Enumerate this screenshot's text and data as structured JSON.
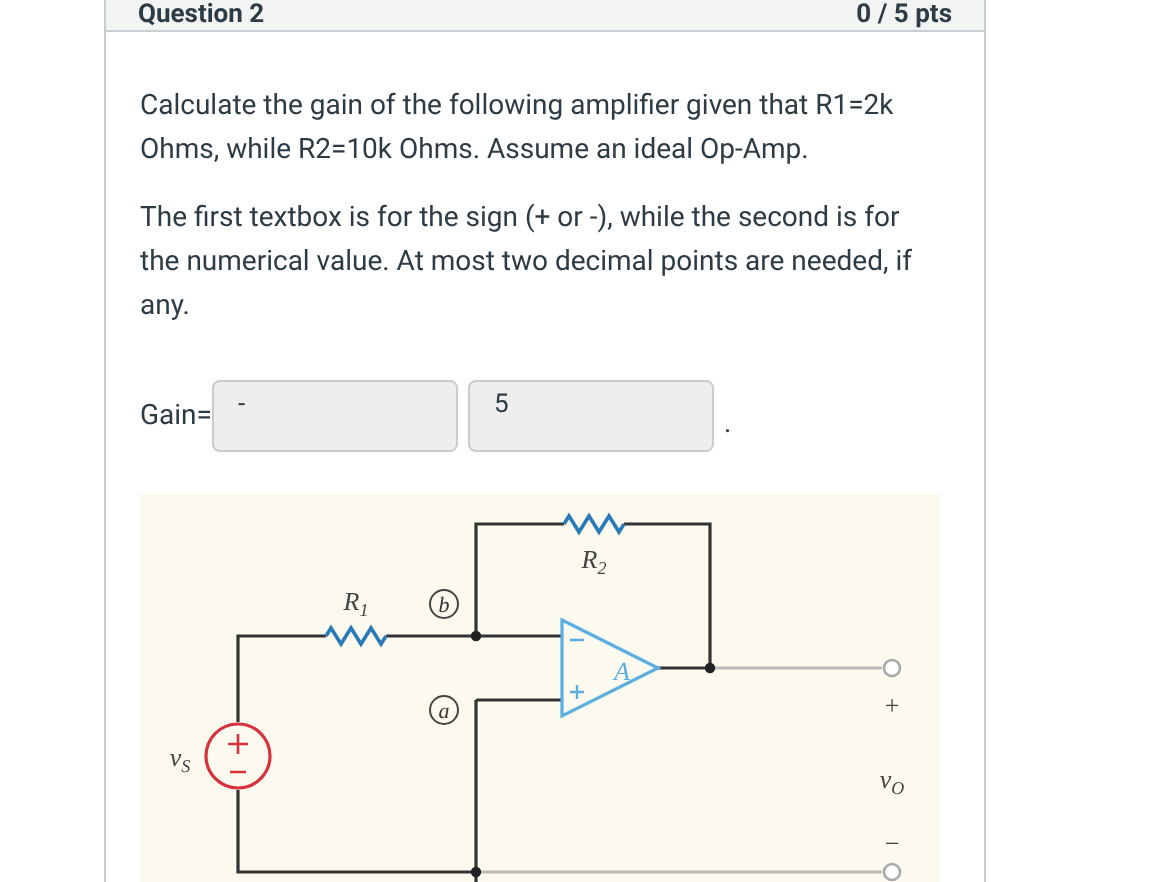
{
  "header": {
    "title": "Question 2",
    "points": "0 / 5 pts"
  },
  "paragraphs": [
    "Calculate the gain of the following amplifier given that R1=2k Ohms, while R2=10k Ohms. Assume an ideal Op-Amp.",
    "The first textbox is for the sign (+ or -), while the second is for the numerical value. At most two decimal points are needed, if any."
  ],
  "answer": {
    "label": "Gain=",
    "sign": "-",
    "value": "5",
    "end": "."
  },
  "diagram": {
    "labels": [
      {
        "text": "R",
        "sub": "2"
      },
      {
        "text": "R",
        "sub": "1"
      },
      {
        "text": "b"
      },
      {
        "text": "A"
      },
      {
        "text": "a"
      },
      {
        "text": "+"
      },
      {
        "text": "v",
        "sub": "S"
      },
      {
        "text": "v",
        "sub": "O"
      },
      {
        "text": "−"
      }
    ]
  }
}
